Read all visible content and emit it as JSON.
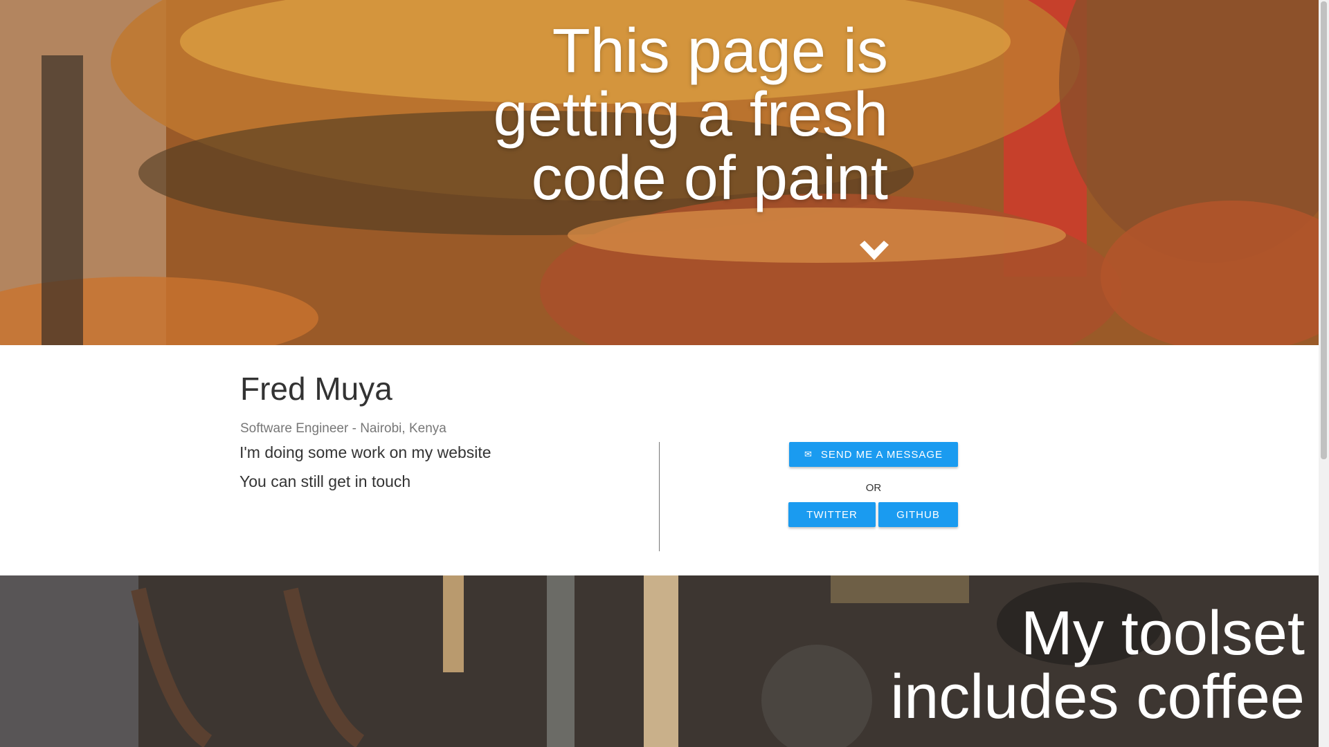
{
  "hero": {
    "title": "This page is getting a fresh code of paint",
    "scroll_icon": "chevron-down-icon"
  },
  "about": {
    "name": "Fred Muya",
    "subtitle": "Software Engineer - Nairobi, Kenya",
    "message_line_1": "I'm doing some work on my website",
    "message_line_2": "You can still get in touch",
    "send_message_label": "SEND ME A MESSAGE",
    "send_message_icon": "envelope-icon",
    "or_label": "OR",
    "twitter_label": "TWITTER",
    "github_label": "GITHUB"
  },
  "tools": {
    "title": "My toolset includes coffee"
  },
  "colors": {
    "button_blue": "#1a9bf0",
    "heading_text": "#333333",
    "muted_text": "#777777"
  }
}
